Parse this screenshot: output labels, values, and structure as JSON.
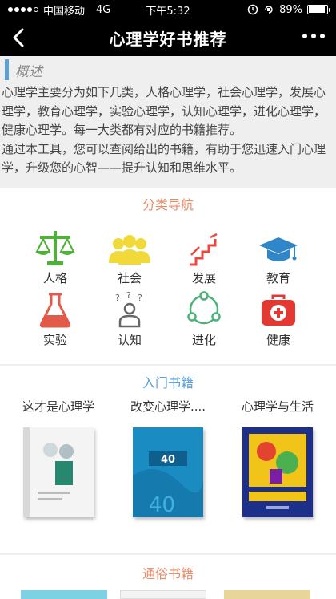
{
  "status": {
    "carrier": "中国移动",
    "network": "4G",
    "time": "下午5:32",
    "battery": "89%",
    "battery_level": 0.89
  },
  "nav": {
    "title": "心理学好书推荐",
    "back_icon": "chevron-left-icon",
    "more_icon": "more-dots-icon"
  },
  "overview": {
    "heading": "概述",
    "para1": "心理学主要分为如下几类，人格心理学，社会心理学，发展心理学，教育心理学，实验心理学，认知心理学，进化心理学，健康心理学。每一大类都有对应的书籍推荐。",
    "para2": "通过本工具，您可以查阅给出的书籍，有助于您迅速入门心理学，升级您的心智——提升认知和思维水平。"
  },
  "categories": {
    "title": "分类导航",
    "items": [
      {
        "label": "人格",
        "icon": "scales-icon",
        "color": "#4cb336"
      },
      {
        "label": "社会",
        "icon": "people-icon",
        "color": "#f2d93a"
      },
      {
        "label": "发展",
        "icon": "stairs-icon",
        "color": "#e84a3e"
      },
      {
        "label": "教育",
        "icon": "graduation-cap-icon",
        "color": "#2f86c9"
      },
      {
        "label": "实验",
        "icon": "flask-icon",
        "color": "#e45a4a"
      },
      {
        "label": "认知",
        "icon": "thinking-person-icon",
        "color": "#666666"
      },
      {
        "label": "进化",
        "icon": "cycle-icon",
        "color": "#4fb07a"
      },
      {
        "label": "健康",
        "icon": "first-aid-kit-icon",
        "color": "#e23a33"
      }
    ]
  },
  "intro_books": {
    "title": "入门书籍",
    "items": [
      {
        "title": "这才是心理学",
        "cover_color": "#f2f2f2"
      },
      {
        "title": "改变心理学....",
        "cover_color": "#1b8cc2"
      },
      {
        "title": "心理学与生活",
        "cover_color": "#1c2f8a"
      }
    ]
  },
  "popular_books": {
    "title": "通俗书籍"
  }
}
